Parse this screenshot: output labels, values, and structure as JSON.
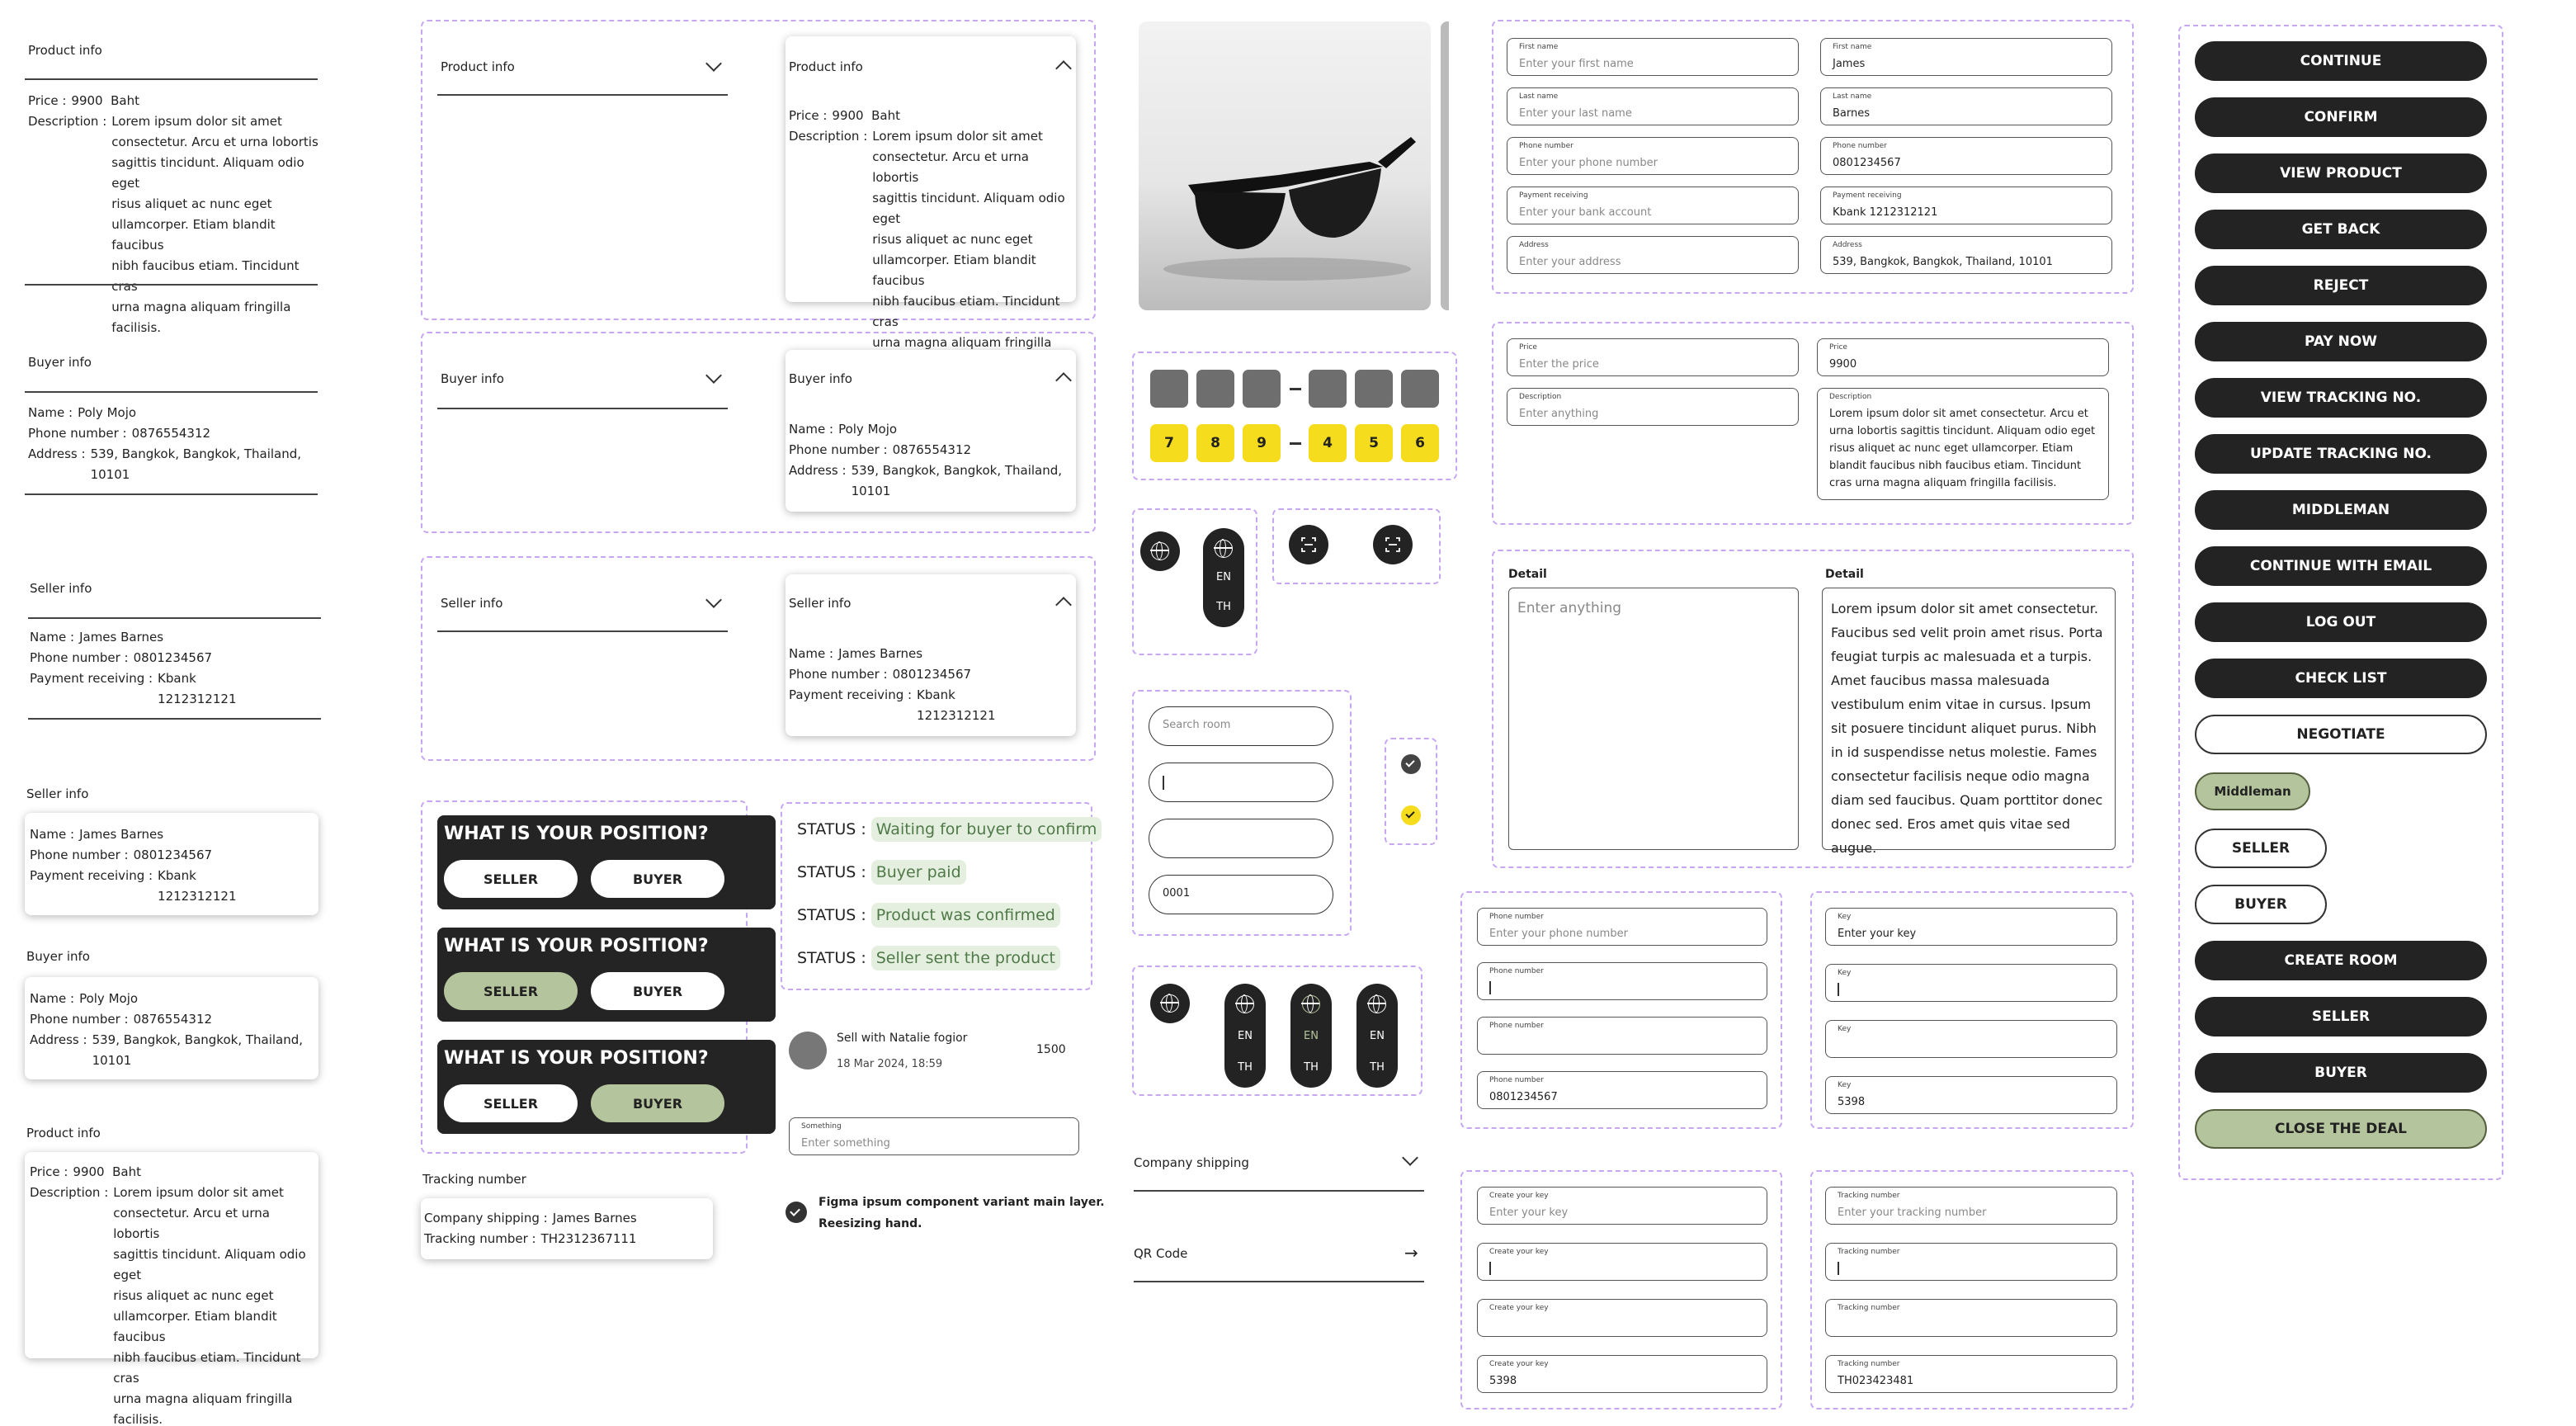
{
  "colors": {
    "dash": "#c7a6f2",
    "dark": "#232323",
    "green": "#b4c49c",
    "yellow": "#f5dd1e",
    "status_bg": "#e4efdf",
    "status_fg": "#4f7a48"
  },
  "product": {
    "title": "Product info",
    "price_k": "Price :",
    "price_v": "9900  Baht",
    "desc_k": "Description :",
    "desc_v": "Lorem ipsum dolor sit amet\nconsectetur. Arcu et urna lobortis\nsagittis tincidunt. Aliquam odio eget\nrisus aliquet ac nunc eget\nullamcorper. Etiam blandit faucibus\nnibh faucibus etiam. Tincidunt cras\nurna magna aliquam fringilla\nfacilisis."
  },
  "buyer": {
    "title": "Buyer info",
    "name_k": "Name :",
    "name_v": "Poly Mojo",
    "phone_k": "Phone number :",
    "phone_v": "0876554312",
    "addr_k": "Address :",
    "addr_v": "539, Bangkok, Bangkok, Thailand,\n10101"
  },
  "seller": {
    "title": "Seller info",
    "name_k": "Name :",
    "name_v": "James Barnes",
    "phone_k": "Phone number :",
    "phone_v": "0801234567",
    "pay_k": "Payment receiving :",
    "pay_v": "Kbank\n1212312121"
  },
  "position": {
    "title": "WHAT IS YOUR POSITION?",
    "seller": "SELLER",
    "buyer": "BUYER"
  },
  "statuses": [
    {
      "k": "STATUS :",
      "v": "Waiting for buyer to confirm"
    },
    {
      "k": "STATUS :",
      "v": "Buyer paid"
    },
    {
      "k": "STATUS :",
      "v": "Product was confirmed"
    },
    {
      "k": "STATUS :",
      "v": "Seller sent the product"
    }
  ],
  "chat": {
    "with": "Sell with  Natalie fogior",
    "date": "18 Mar 2024, 18:59",
    "amount": "1500",
    "something_label": "Something",
    "something_ph": "Enter something"
  },
  "check_text": "Figma ipsum component variant main layer.\nReesizing hand.",
  "tracking": {
    "title": "Tracking number",
    "ship_k": "Company shipping :",
    "ship_v": "James Barnes",
    "num_k": "Tracking number :",
    "num_v": "TH2312367111"
  },
  "digits": [
    "7",
    "8",
    "9",
    "4",
    "5",
    "6"
  ],
  "lang": {
    "en": "EN",
    "th": "TH"
  },
  "search": {
    "placeholder": "Search room",
    "value4": "0001"
  },
  "menu": {
    "shipping": "Company shipping",
    "qr": "QR Code"
  },
  "form": {
    "first_l": "First name",
    "first_ph": "Enter your first name",
    "first_v": "James",
    "last_l": "Last name",
    "last_ph": "Enter your last name",
    "last_v": "Barnes",
    "phone_l": "Phone number",
    "phone_ph": "Enter your phone number",
    "phone_v": "0801234567",
    "pay_l": "Payment receiving",
    "pay_ph": "Enter your bank account",
    "pay_v": "Kbank 1212312121",
    "addr_l": "Address",
    "addr_ph": "Enter your address",
    "addr_v": "539, Bangkok, Bangkok, Thailand, 10101",
    "price_l": "Price",
    "price_ph": "Enter the price",
    "price_v": "9900",
    "desc_l": "Description",
    "desc_ph": "Enter anything",
    "desc_v": "Lorem ipsum dolor sit amet consectetur. Arcu et urna lobortis sagittis tincidunt. Aliquam odio eget risus aliquet ac nunc eget ullamcorper. Etiam blandit faucibus nibh faucibus etiam. Tincidunt cras urna magna aliquam fringilla facilisis.",
    "detail_l": "Detail",
    "detail_ph": "Enter anything",
    "detail_v": "Lorem ipsum dolor sit amet consectetur. Faucibus sed velit proin amet risus. Porta feugiat turpis ac malesuada et a turpis. Amet faucibus massa malesuada vestibulum enim vitae in cursus. Ipsum sit posuere tincidunt aliquet purus. Nibh in id suspendisse netus molestie. Fames consectetur facilisis neque odio magna diam sed faucibus. Quam porttitor donec donec sed. Eros amet quis vitae sed augue."
  },
  "phone_fields": {
    "label": "Phone number",
    "ph": "Enter your phone number",
    "v": "0801234567"
  },
  "key_fields": {
    "label": "Key",
    "ph": "Enter your key",
    "v": "5398"
  },
  "create_key": {
    "label": "Create your key",
    "ph": "Enter your key",
    "v": "5398"
  },
  "tracking_fields": {
    "label": "Tracking number",
    "ph": "Enter your tracking number",
    "v": "TH023423481"
  },
  "buttons": {
    "continue": "CONTINUE",
    "confirm": "CONFIRM",
    "view_product": "VIEW PRODUCT",
    "get_back": "GET BACK",
    "reject": "REJECT",
    "pay_now": "PAY NOW",
    "view_tracking": "VIEW TRACKING NO.",
    "update_tracking": "UPDATE TRACKING NO.",
    "middleman": "MIDDLEMAN",
    "continue_email": "CONTINUE WITH EMAIL",
    "log_out": "LOG OUT",
    "check_list": "CHECK LIST",
    "negotiate": "NEGOTIATE",
    "middleman_tag": "Middleman",
    "seller": "SELLER",
    "buyer": "BUYER",
    "create_room": "CREATE ROOM",
    "close_deal": "CLOSE THE DEAL"
  }
}
